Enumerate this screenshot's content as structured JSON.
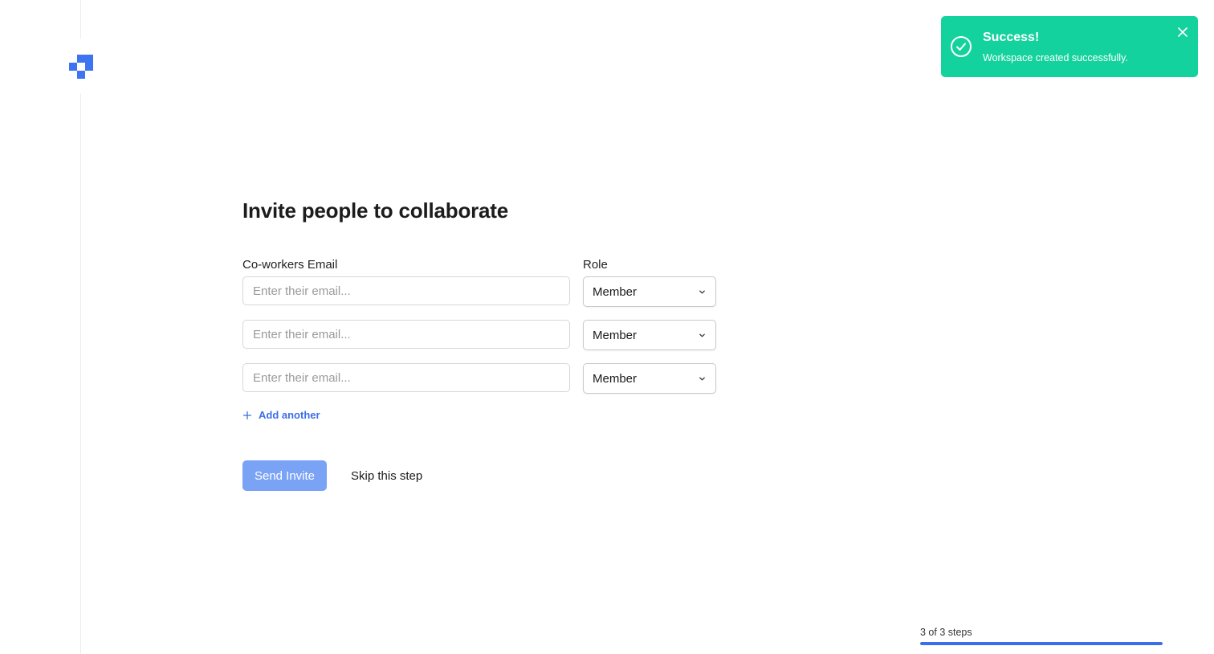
{
  "brand": {
    "logo_icon": "pixel-blocks-logo-icon",
    "accent": "#3f74f0"
  },
  "toast": {
    "title": "Success!",
    "message": "Workspace created successfully.",
    "color": "#14d29d",
    "icon": "check-circle-icon",
    "close_icon": "close-icon"
  },
  "form": {
    "title": "Invite people to collaborate",
    "email_label": "Co-workers Email",
    "role_label": "Role",
    "rows": [
      {
        "email": "",
        "placeholder": "Enter their email...",
        "role": "Member"
      },
      {
        "email": "",
        "placeholder": "Enter their email...",
        "role": "Member"
      },
      {
        "email": "",
        "placeholder": "Enter their email...",
        "role": "Member"
      }
    ],
    "add_another_label": "Add another",
    "send_label": "Send Invite",
    "skip_label": "Skip this step"
  },
  "progress": {
    "text": "3 of 3 steps",
    "fraction": 1.0,
    "color": "#3b6ee8"
  }
}
